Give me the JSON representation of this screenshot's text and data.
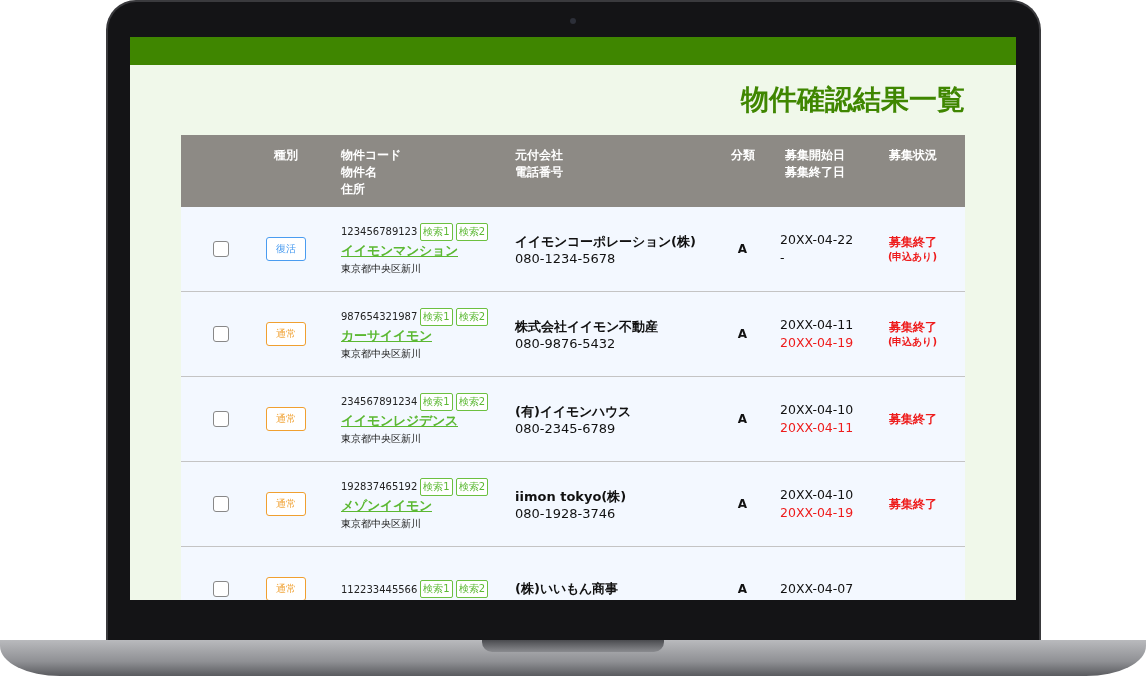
{
  "page": {
    "title": "物件確認結果一覧"
  },
  "table": {
    "columns": [
      {},
      {
        "lines": [
          "種別"
        ]
      },
      {
        "lines": [
          "物件コード",
          "物件名",
          "住所"
        ]
      },
      {
        "lines": [
          "元付会社",
          "電話番号"
        ]
      },
      {
        "lines": [
          "分類"
        ]
      },
      {
        "lines": [
          "募集開始日",
          "募集終了日"
        ]
      },
      {
        "lines": [
          "募集状況"
        ]
      }
    ],
    "rows": [
      {
        "checked": false,
        "type": {
          "label": "復活",
          "kind": "revival"
        },
        "code": "123456789123",
        "search_buttons": [
          "検索1",
          "検索2"
        ],
        "name": "イイモンマンション",
        "address": "東京都中央区新川",
        "company": "イイモンコーポレーション(株)",
        "phone": "080-1234-5678",
        "category": "A",
        "start": "20XX-04-22",
        "end": {
          "text": "-",
          "overdue": false
        },
        "status": "募集終了",
        "status_note": "(申込あり)"
      },
      {
        "checked": false,
        "type": {
          "label": "通常",
          "kind": "normal"
        },
        "code": "987654321987",
        "search_buttons": [
          "検索1",
          "検索2"
        ],
        "name": "カーサイイモン",
        "address": "東京都中央区新川",
        "company": "株式会社イイモン不動産",
        "phone": "080-9876-5432",
        "category": "A",
        "start": "20XX-04-11",
        "end": {
          "text": "20XX-04-19",
          "overdue": true
        },
        "status": "募集終了",
        "status_note": "(申込あり)"
      },
      {
        "checked": false,
        "type": {
          "label": "通常",
          "kind": "normal"
        },
        "code": "234567891234",
        "search_buttons": [
          "検索1",
          "検索2"
        ],
        "name": "イイモンレジデンス",
        "address": "東京都中央区新川",
        "company": "(有)イイモンハウス",
        "phone": "080-2345-6789",
        "category": "A",
        "start": "20XX-04-10",
        "end": {
          "text": "20XX-04-11",
          "overdue": true
        },
        "status": "募集終了"
      },
      {
        "checked": false,
        "type": {
          "label": "通常",
          "kind": "normal"
        },
        "code": "192837465192",
        "search_buttons": [
          "検索1",
          "検索2"
        ],
        "name": "メゾンイイモン",
        "address": "東京都中央区新川",
        "company": "iimon tokyo(株)",
        "phone": "080-1928-3746",
        "category": "A",
        "start": "20XX-04-10",
        "end": {
          "text": "20XX-04-19",
          "overdue": true
        },
        "status": "募集終了"
      },
      {
        "checked": false,
        "type": {
          "label": "通常",
          "kind": "normal"
        },
        "code": "112233445566",
        "search_buttons": [
          "検索1",
          "検索2"
        ],
        "company": "(株)いいもん商事",
        "category": "A",
        "start": "20XX-04-07"
      }
    ]
  }
}
